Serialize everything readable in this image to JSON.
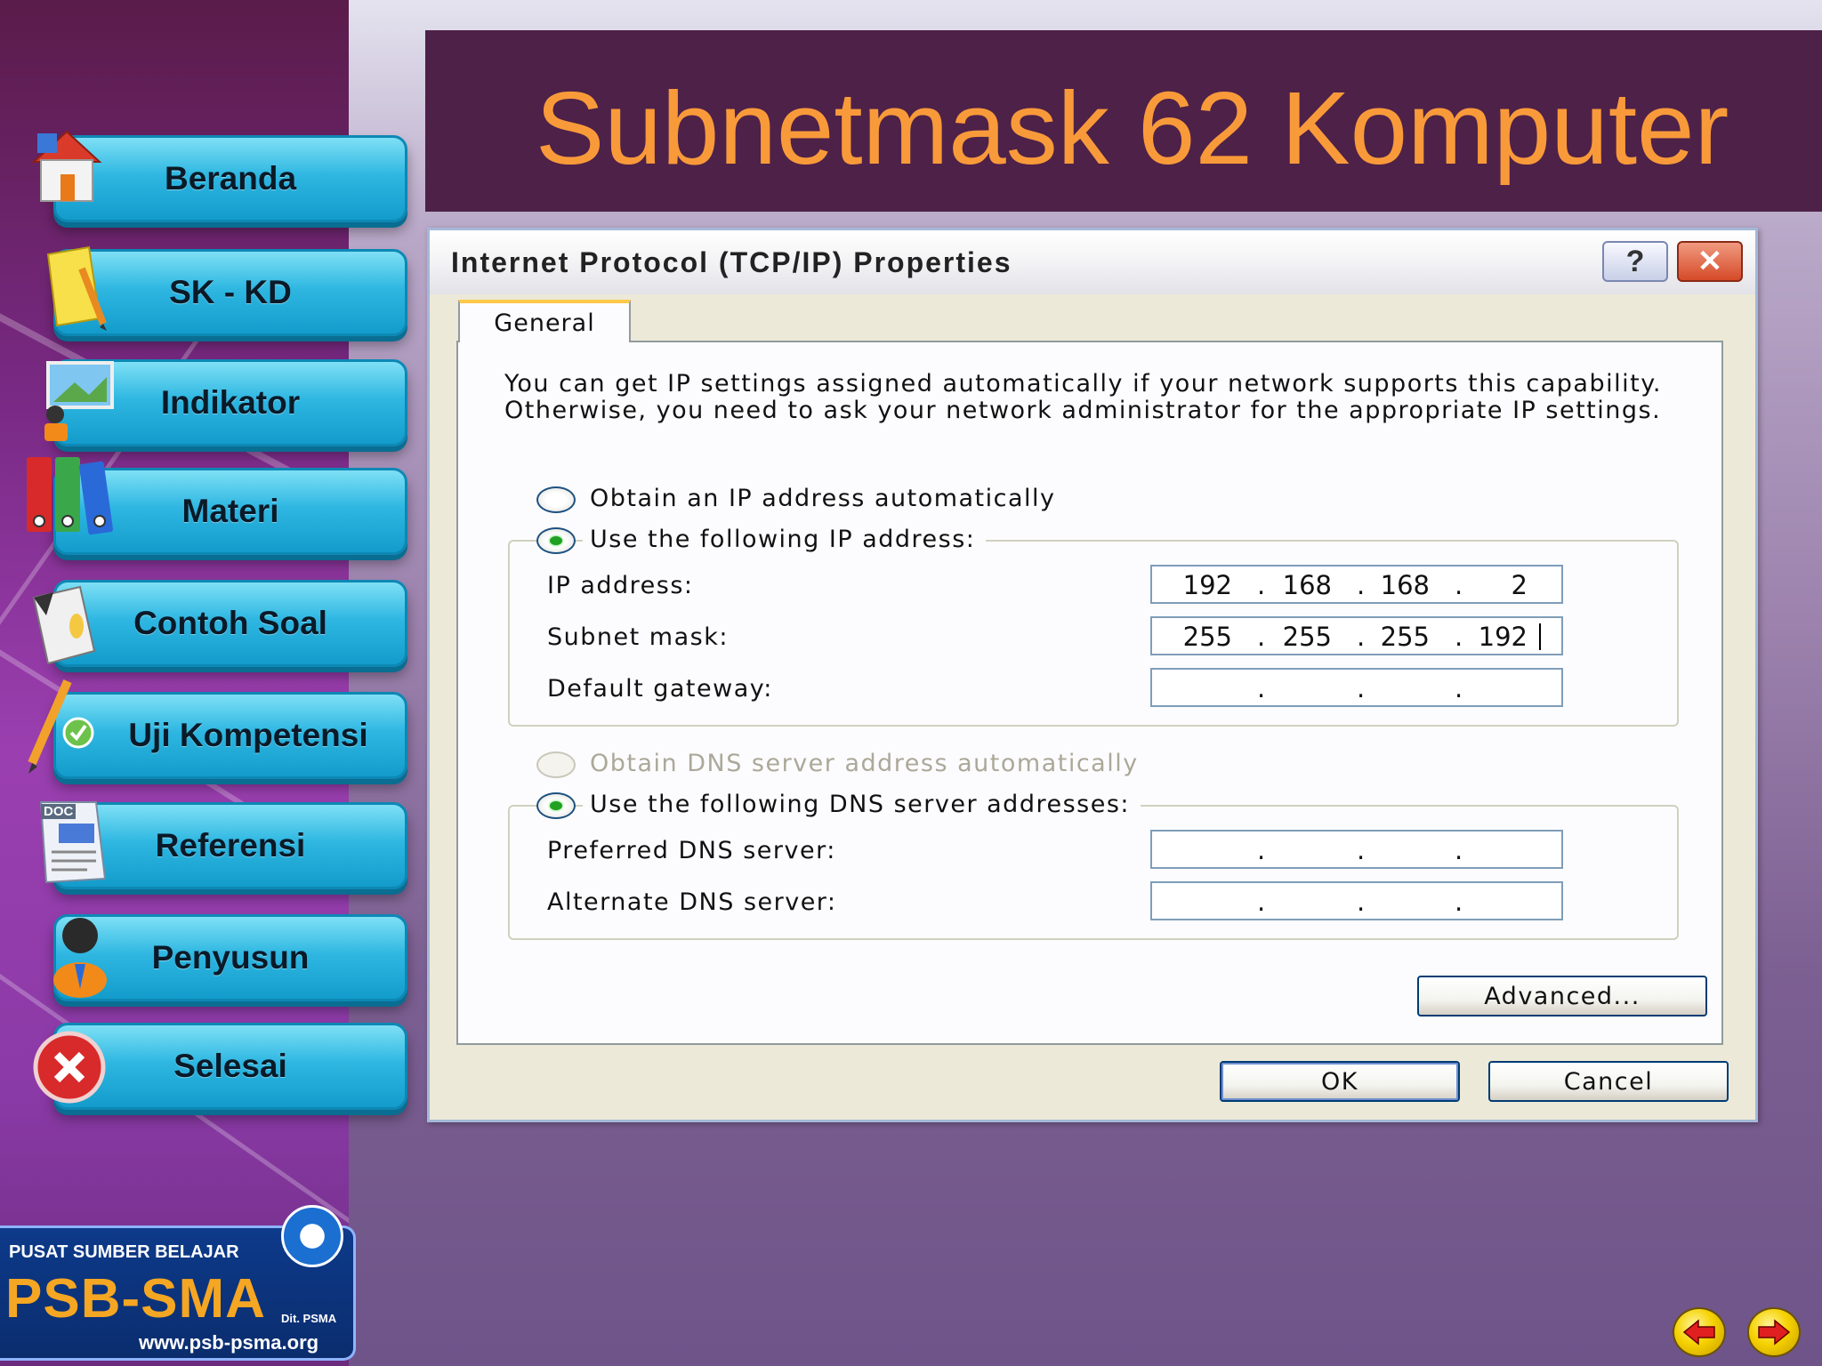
{
  "slide": {
    "title": "Subnetmask 62 Komputer"
  },
  "nav": {
    "items": [
      {
        "label": "Beranda",
        "icon": "house-icon"
      },
      {
        "label": "SK - KD",
        "icon": "notepad-pencil-icon"
      },
      {
        "label": "Indikator",
        "icon": "presentation-board-icon"
      },
      {
        "label": "Materi",
        "icon": "binders-icon"
      },
      {
        "label": "Contoh Soal",
        "icon": "document-pen-icon"
      },
      {
        "label": "Uji Kompetensi",
        "icon": "pencil-check-icon"
      },
      {
        "label": "Referensi",
        "icon": "doc-file-icon"
      },
      {
        "label": "Penyusun",
        "icon": "person-icon"
      },
      {
        "label": "Selesai",
        "icon": "close-circle-icon"
      }
    ]
  },
  "dialog": {
    "title": "Internet Protocol (TCP/IP) Properties",
    "help_glyph": "?",
    "close_glyph": "✕",
    "tab": "General",
    "intro": "You can get IP settings assigned automatically if your network supports this capability. Otherwise, you need to ask your network administrator for the appropriate IP settings.",
    "radio_obtain_ip": "Obtain an IP address automatically",
    "radio_use_ip": "Use the following IP address:",
    "ip_label": "IP address:",
    "ip_value": [
      "192",
      "168",
      "168",
      "2"
    ],
    "subnet_label": "Subnet mask:",
    "subnet_value": [
      "255",
      "255",
      "255",
      "192"
    ],
    "gateway_label": "Default gateway:",
    "radio_obtain_dns": "Obtain DNS server address automatically",
    "radio_use_dns": "Use the following DNS server addresses:",
    "preferred_dns_label": "Preferred DNS server:",
    "alternate_dns_label": "Alternate DNS server:",
    "advanced_button": "Advanced...",
    "ok_button": "OK",
    "cancel_button": "Cancel",
    "selected_ip_mode": "use_following",
    "selected_dns_mode": "use_following",
    "dns_auto_disabled": true
  },
  "logo": {
    "top_text": "PUSAT SUMBER BELAJAR",
    "main_text": "PSB-SMA",
    "sub_text": "Dit. PSMA",
    "url": "www.psb-psma.org"
  },
  "colors": {
    "title_color": "#f99a3a",
    "banner": "#4e2148",
    "nav_button": "#2fb7e2"
  }
}
